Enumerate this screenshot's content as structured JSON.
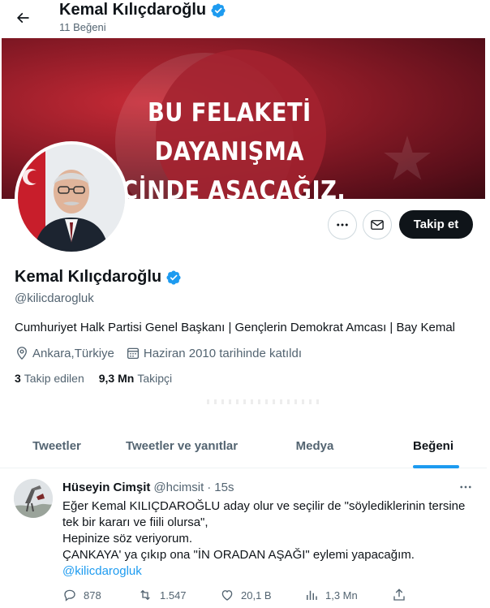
{
  "header": {
    "name": "Kemal Kılıçdaroğlu",
    "subtitle": "11 Beğeni"
  },
  "banner": {
    "line1": "BU FELAKETİ DAYANIŞMA",
    "line2": "İÇİNDE AŞACAĞIZ."
  },
  "actions": {
    "follow_label": "Takip et"
  },
  "profile": {
    "name": "Kemal Kılıçdaroğlu",
    "handle": "@kilicdarogluk",
    "bio": "Cumhuriyet Halk Partisi Genel Başkanı | Gençlerin Demokrat Amcası | Bay Kemal",
    "location": "Ankara,Türkiye",
    "joined": "Haziran 2010 tarihinde katıldı",
    "following_count": "3",
    "following_label": "Takip edilen",
    "followers_count": "9,3 Mn",
    "followers_label": "Takipçi"
  },
  "tabs": [
    {
      "label": "Tweetler",
      "active": false
    },
    {
      "label": "Tweetler ve yanıtlar",
      "active": false
    },
    {
      "label": "Medya",
      "active": false
    },
    {
      "label": "Beğeni",
      "active": true
    }
  ],
  "tweet": {
    "author": "Hüseyin Cimşit",
    "handle": "@hcimsit",
    "separator": "·",
    "time": "15s",
    "lines": [
      "Eğer Kemal KILIÇDAROĞLU aday olur ve seçilir de \"söylediklerinin tersine",
      "tek bir kararı ve fiili olursa\",",
      "Hepinize söz veriyorum.",
      "ÇANKAYA' ya çıkıp ona \"İN ORADAN AŞAĞI\" eylemi yapacağım."
    ],
    "mention": "@kilicdarogluk",
    "replies": "878",
    "retweets": "1.547",
    "likes": "20,1 B",
    "views": "1,3 Mn"
  },
  "colors": {
    "accent": "#1d9bf0",
    "text": "#0f1419",
    "muted": "#536471",
    "button_dark": "#0f1419"
  },
  "icons": [
    "back-arrow-icon",
    "verified-badge-icon",
    "more-icon",
    "mail-icon",
    "location-icon",
    "calendar-icon",
    "reply-icon",
    "retweet-icon",
    "like-icon",
    "views-icon",
    "share-icon"
  ]
}
